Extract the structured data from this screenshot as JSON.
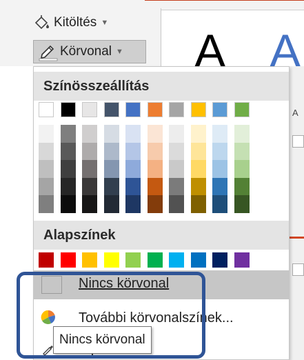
{
  "ribbon": {
    "fill_label": "Kitöltés",
    "outline_label": "Körvonal",
    "preview_letter_1": "A",
    "preview_letter_2": "A"
  },
  "menu": {
    "theme_colors_header": "Színösszeállítás",
    "standard_colors_header": "Alapszínek",
    "no_outline_label": "Nincs körvonal",
    "more_colors_label": "További körvonalszínek...",
    "eyedropper_label": "Pipetta"
  },
  "tooltip": {
    "text": "Nincs körvonal"
  },
  "right_panel": {
    "fragment_text": "A"
  },
  "colors": {
    "theme_top": [
      "#ffffff",
      "#000000",
      "#e7e6e6",
      "#44546a",
      "#4472c4",
      "#ed7d31",
      "#a5a5a5",
      "#ffc000",
      "#5b9bd5",
      "#70ad47"
    ],
    "theme_shades": [
      [
        "#f2f2f2",
        "#7f7f7f",
        "#d0cece",
        "#d6dce4",
        "#d9e2f3",
        "#fbe5d5",
        "#ededed",
        "#fff2cc",
        "#deebf6",
        "#e2efd9"
      ],
      [
        "#d8d8d8",
        "#595959",
        "#aeabab",
        "#adb9ca",
        "#b4c6e7",
        "#f7cbac",
        "#dbdbdb",
        "#fee599",
        "#bdd7ee",
        "#c5e0b3"
      ],
      [
        "#bfbfbf",
        "#3f3f3f",
        "#757070",
        "#8496b0",
        "#8eaadb",
        "#f4b183",
        "#c9c9c9",
        "#ffd965",
        "#9cc3e5",
        "#a8d08d"
      ],
      [
        "#a5a5a5",
        "#262626",
        "#3a3838",
        "#323f4f",
        "#2e5496",
        "#c45911",
        "#7b7b7b",
        "#bf8f00",
        "#2e75b5",
        "#538135"
      ],
      [
        "#7f7f7f",
        "#0c0c0c",
        "#171616",
        "#222a35",
        "#1e3763",
        "#833c0b",
        "#525252",
        "#7f6000",
        "#1e4e79",
        "#375623"
      ]
    ],
    "standard": [
      "#c00000",
      "#ff0000",
      "#ffc000",
      "#ffff00",
      "#92d050",
      "#00b050",
      "#00b0f0",
      "#0070c0",
      "#002060",
      "#7030a0"
    ],
    "focus_ring": "#2f5496",
    "ribbon_accent": "#c43e1c"
  }
}
